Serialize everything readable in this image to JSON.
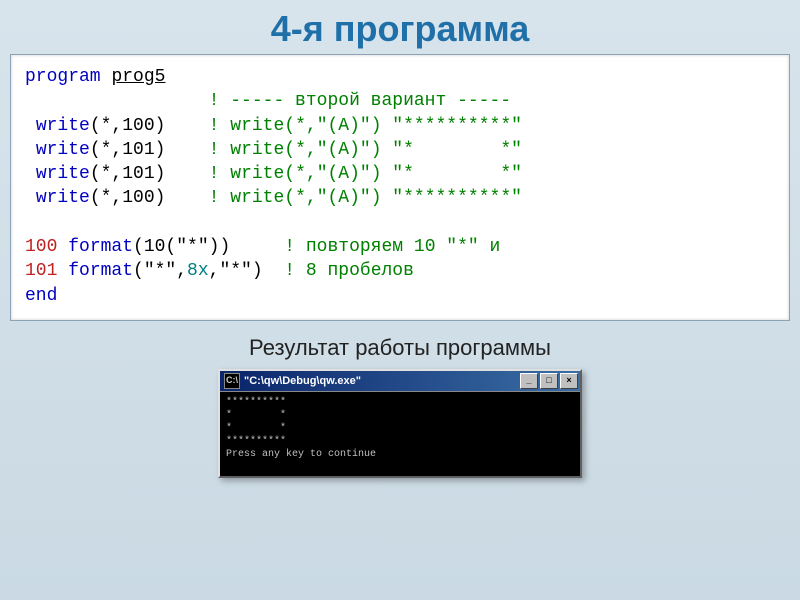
{
  "title": "4-я программа",
  "code": {
    "l1": {
      "program": "program",
      "name": "prog5"
    },
    "l2": {
      "comment": "! ----- второй вариант -----"
    },
    "l3": {
      "write": "write",
      "args": "(*,100)",
      "cm": "! write(*,\"(A)\") \"**********\""
    },
    "l4": {
      "write": "write",
      "args": "(*,101)",
      "cm": "! write(*,\"(A)\") \"*        *\""
    },
    "l5": {
      "write": "write",
      "args": "(*,101)",
      "cm": "! write(*,\"(A)\") \"*        *\""
    },
    "l6": {
      "write": "write",
      "args": "(*,100)",
      "cm": "! write(*,\"(A)\") \"**********\""
    },
    "l8": {
      "num": "100",
      "format": "format",
      "args": "(10(\"*\"))",
      "cm": "! повторяем 10 \"*\" и"
    },
    "l9": {
      "num": "101",
      "format": "format",
      "args1": "(\"*\",",
      "x8": "8x",
      "args2": ",\"*\")",
      "cm": "! 8 пробелов"
    },
    "end": "end"
  },
  "subtitle": "Результат работы программы",
  "console": {
    "icon": "C:\\",
    "title": "\"C:\\qw\\Debug\\qw.exe\"",
    "btn_min": "_",
    "btn_max": "□",
    "btn_close": "×",
    "out1": "**********",
    "out2": "*        *",
    "out3": "*        *",
    "out4": "**********",
    "out5": "Press any key to continue"
  },
  "chart_data": {
    "type": "table",
    "title": "Fortran source listing",
    "rows": [
      "program prog5",
      "                 ! ----- второй вариант -----",
      " write(*,100)    ! write(*,\"(A)\") \"**********\"",
      " write(*,101)    ! write(*,\"(A)\") \"*        *\"",
      " write(*,101)    ! write(*,\"(A)\") \"*        *\"",
      " write(*,100)    ! write(*,\"(A)\") \"**********\"",
      "",
      "100 format(10(\"*\"))     ! повторяем 10 \"*\" и",
      "101 format(\"*\",8x,\"*\")  ! 8 пробелов",
      "end"
    ],
    "output": [
      "**********",
      "*        *",
      "*        *",
      "**********",
      "Press any key to continue"
    ]
  }
}
